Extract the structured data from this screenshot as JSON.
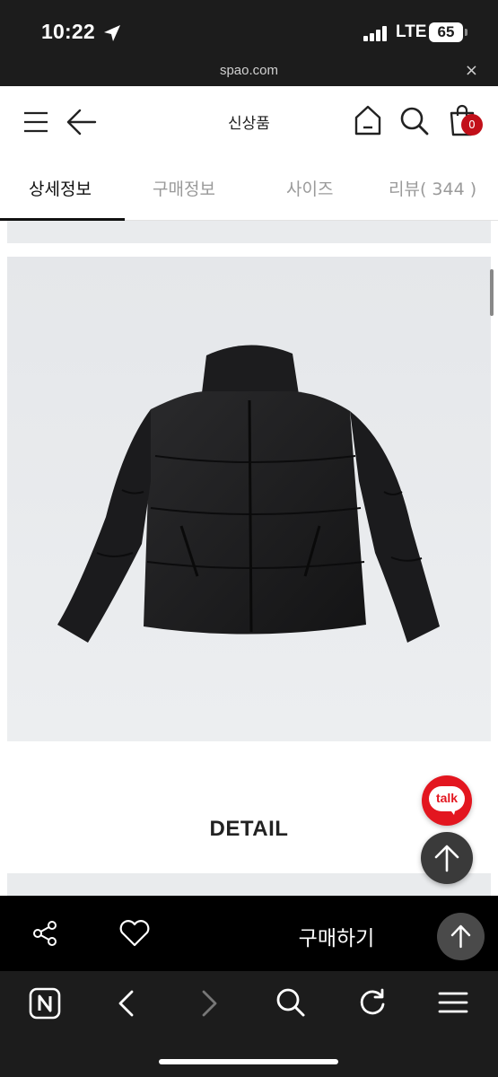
{
  "status_bar": {
    "time": "10:22",
    "network": "LTE",
    "battery": "65",
    "icons": [
      "location-arrow-icon",
      "signal-icon"
    ]
  },
  "url_bar": {
    "url": "spao.com",
    "close_label": "×"
  },
  "header": {
    "title": "신상품",
    "cart_count": "0",
    "icons": [
      "menu-icon",
      "back-arrow-icon",
      "home-icon",
      "search-icon",
      "shopping-bag-icon"
    ]
  },
  "tabs": [
    {
      "label": "상세정보",
      "active": true
    },
    {
      "label": "구매정보",
      "active": false
    },
    {
      "label": "사이즈",
      "active": false
    },
    {
      "label": "리뷰( 344 )",
      "active": false
    }
  ],
  "content": {
    "section_heading": "DETAIL"
  },
  "floating": {
    "talk_label": "talk",
    "icons": [
      "talk-icon",
      "scroll-top-icon"
    ]
  },
  "buy_bar": {
    "buy_label": "구매하기",
    "icons": [
      "share-icon",
      "heart-icon",
      "scroll-top-icon"
    ]
  },
  "browser_nav": {
    "icons": [
      "naver-home-icon",
      "back-icon",
      "forward-icon",
      "search-icon",
      "reload-icon",
      "menu-icon"
    ]
  },
  "colors": {
    "accent": "#c2101a",
    "talk": "#e3161f",
    "status_bg": "#1c1c1c",
    "buy_bar_bg": "#000000"
  }
}
